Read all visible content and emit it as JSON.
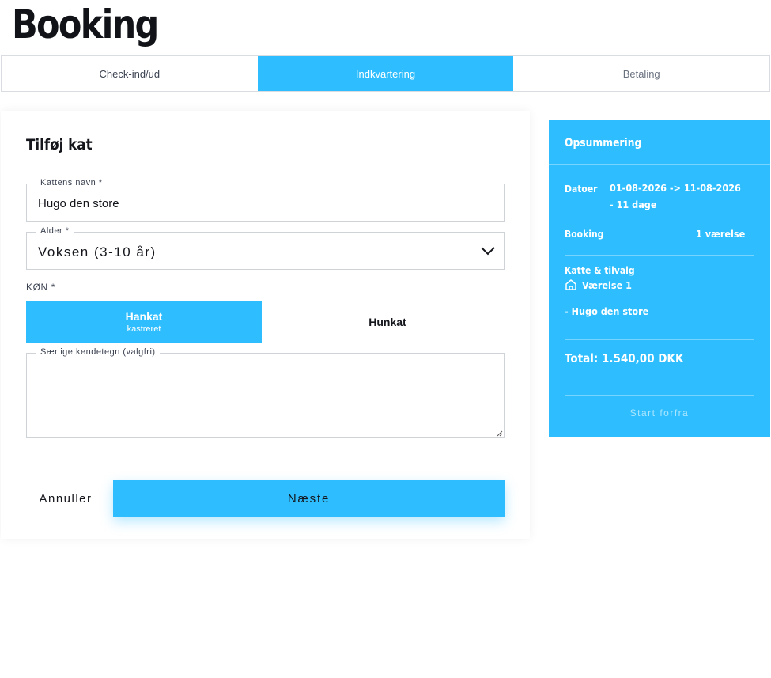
{
  "page": {
    "title": "Booking"
  },
  "steps": [
    {
      "label": "Check-ind/ud"
    },
    {
      "label": "Indkvartering"
    },
    {
      "label": "Betaling"
    }
  ],
  "form": {
    "title": "Tilføj kat",
    "name_field": {
      "label": "Kattens navn *",
      "value": "Hugo den store"
    },
    "age_field": {
      "label": "Alder *",
      "value": "Voksen (3-10 år)"
    },
    "gender": {
      "label": "KØN *",
      "male": {
        "label": "Hankat",
        "sub": "kastreret"
      },
      "female": {
        "label": "Hunkat"
      }
    },
    "marks_field": {
      "label": "Særlige kendetegn (valgfri)",
      "value": ""
    },
    "cancel_label": "Annuller",
    "next_label": "Næste"
  },
  "summary": {
    "title": "Opsummering",
    "dates_key": "Datoer",
    "dates_value": "01-08-2026 -> 11-08-2026",
    "duration": "- 11 dage",
    "booking_key": "Booking",
    "booking_value": "1 værelse",
    "cats_key": "Katte & tilvalg",
    "room_label": "Værelse 1",
    "cat_item": "- Hugo den store",
    "total": "Total: 1.540,00 DKK",
    "start_over": "Start forfra"
  },
  "colors": {
    "accent": "#2ebeff",
    "text": "#14161c"
  },
  "icons": {
    "room": "house-icon",
    "age_select": "chevron-down-icon"
  }
}
